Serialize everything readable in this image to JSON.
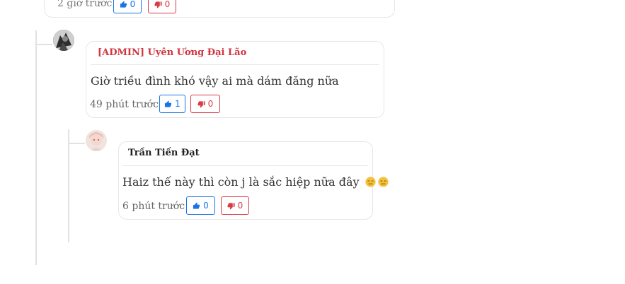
{
  "comments": [
    {
      "time": "2 giờ trước",
      "likes": "0",
      "dislikes": "0"
    },
    {
      "author": "[ADMIN] Uyên Ương Đại Lão",
      "author_color": "#d0353f",
      "content": "Giờ triều đình khó vậy ai mà dám đăng nữa",
      "time": "49 phút trước",
      "likes": "1",
      "dislikes": "0"
    },
    {
      "author": "Trần Tiến Đạt",
      "author_color": "#222222",
      "content": "Haiz thế này thì còn j là sắc hiệp nữa đây",
      "emojis": [
        "expressionless-face-emoji",
        "expressionless-face-emoji"
      ],
      "time": "6 phút trước",
      "likes": "0",
      "dislikes": "0"
    }
  ],
  "colors": {
    "like": "#1a73e8",
    "dislike": "#d93b45",
    "border": "#e6e6e6",
    "thread_line": "#e2e2e2"
  },
  "icons": {
    "like": "thumbs-up-icon",
    "dislike": "thumbs-down-icon"
  }
}
